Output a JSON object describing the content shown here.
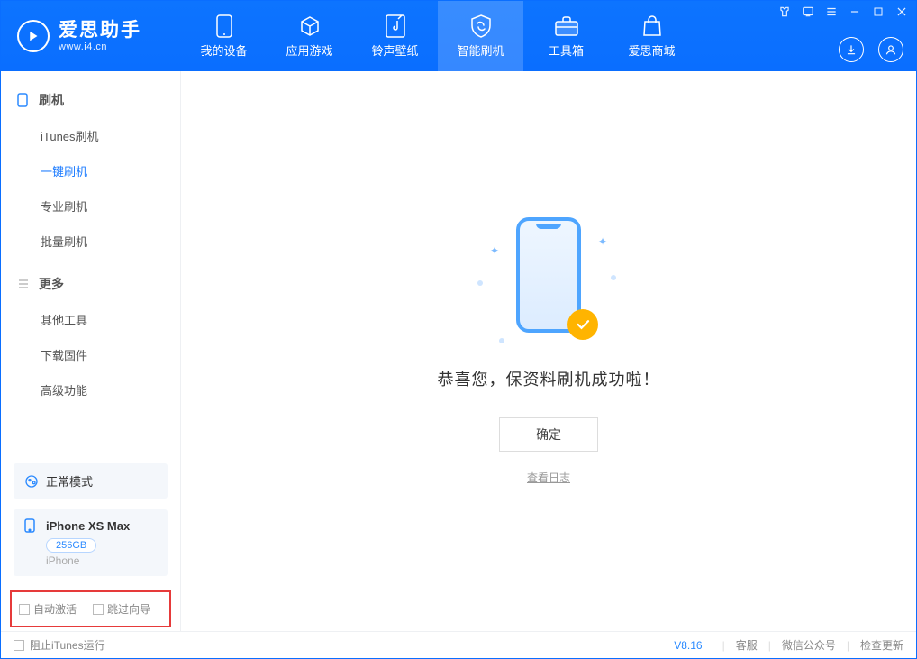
{
  "app": {
    "title": "爱思助手",
    "subtitle": "www.i4.cn"
  },
  "nav": {
    "items": [
      {
        "label": "我的设备"
      },
      {
        "label": "应用游戏"
      },
      {
        "label": "铃声壁纸"
      },
      {
        "label": "智能刷机"
      },
      {
        "label": "工具箱"
      },
      {
        "label": "爱思商城"
      }
    ],
    "active_index": 3
  },
  "sidebar": {
    "section1": {
      "title": "刷机",
      "items": [
        "iTunes刷机",
        "一键刷机",
        "专业刷机",
        "批量刷机"
      ],
      "active_index": 1
    },
    "section2": {
      "title": "更多",
      "items": [
        "其他工具",
        "下载固件",
        "高级功能"
      ]
    },
    "mode": {
      "label": "正常模式"
    },
    "device": {
      "name": "iPhone XS Max",
      "capacity": "256GB",
      "type": "iPhone"
    },
    "options": {
      "auto_activate": "自动激活",
      "skip_guide": "跳过向导"
    }
  },
  "main": {
    "success_text": "恭喜您，保资料刷机成功啦！",
    "ok_button": "确定",
    "view_log": "查看日志"
  },
  "footer": {
    "block_itunes": "阻止iTunes运行",
    "version": "V8.16",
    "links": [
      "客服",
      "微信公众号",
      "检查更新"
    ]
  }
}
